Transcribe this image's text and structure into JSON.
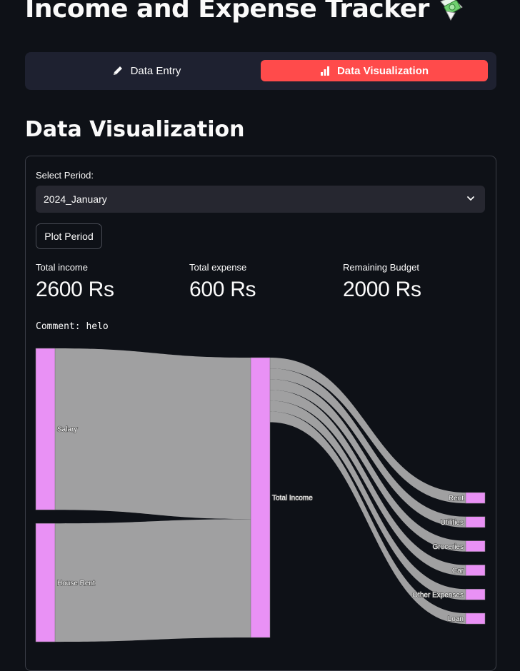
{
  "app": {
    "title": "Income and Expense Tracker",
    "title_emoji_icon": "money-with-wings-icon"
  },
  "tabs": [
    {
      "label": "Data Entry",
      "icon": "pencil-icon",
      "active": false
    },
    {
      "label": "Data Visualization",
      "icon": "bar-chart-icon",
      "active": true
    }
  ],
  "section": {
    "heading": "Data Visualization"
  },
  "form": {
    "period_label": "Select Period:",
    "period_value": "2024_January",
    "plot_button": "Plot Period"
  },
  "metrics": [
    {
      "label": "Total income",
      "value": "2600 Rs"
    },
    {
      "label": "Total expense",
      "value": "600 Rs"
    },
    {
      "label": "Remaining Budget",
      "value": "2000 Rs"
    }
  ],
  "comment": "Comment: helo",
  "colors": {
    "background": "#0e1117",
    "accent": "#ff4b4b",
    "node": "#e991f5",
    "link": "#a9a9a9"
  },
  "chart_data": {
    "type": "sankey",
    "nodes": [
      "Salary",
      "House Rent",
      "Total Income",
      "Rent",
      "Utilities",
      "Groceries",
      "Car",
      "Other Expenses",
      "Loan"
    ],
    "links": [
      {
        "source": "Salary",
        "target": "Total Income",
        "value": 1500
      },
      {
        "source": "House Rent",
        "target": "Total Income",
        "value": 1100
      },
      {
        "source": "Total Income",
        "target": "Rent",
        "value": 100
      },
      {
        "source": "Total Income",
        "target": "Utilities",
        "value": 100
      },
      {
        "source": "Total Income",
        "target": "Groceries",
        "value": 100
      },
      {
        "source": "Total Income",
        "target": "Car",
        "value": 100
      },
      {
        "source": "Total Income",
        "target": "Other Expenses",
        "value": 100
      },
      {
        "source": "Total Income",
        "target": "Loan",
        "value": 100
      }
    ]
  }
}
